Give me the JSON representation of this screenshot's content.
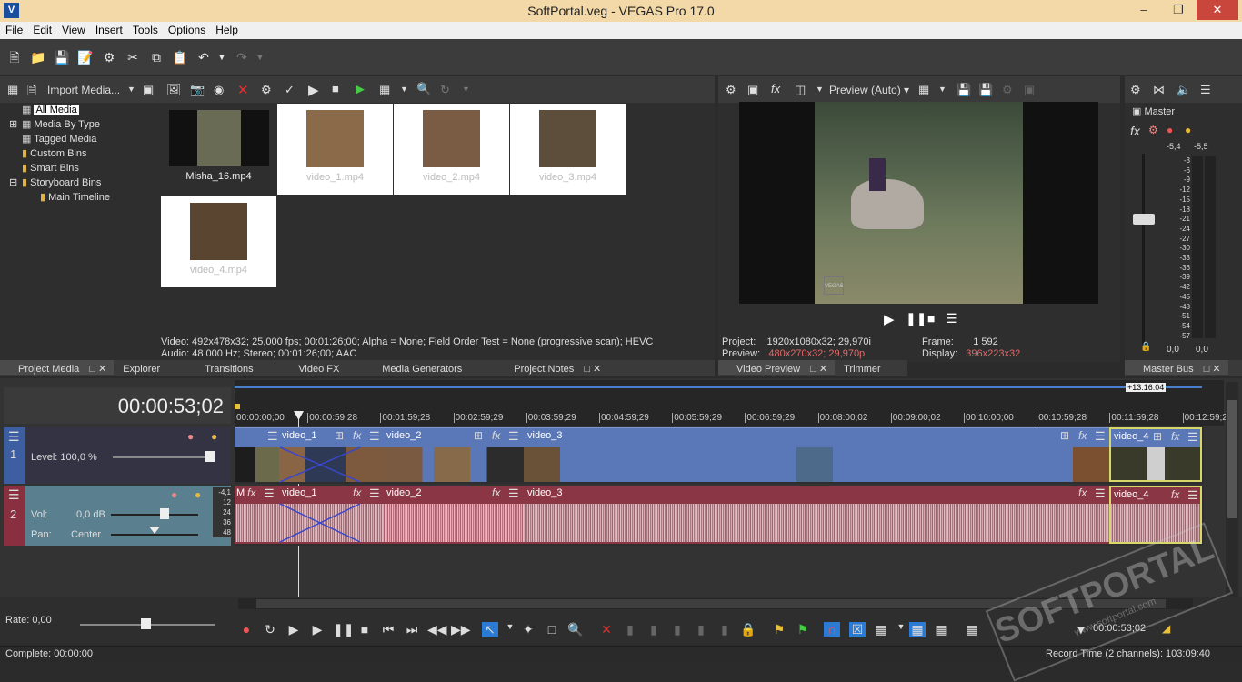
{
  "window": {
    "title": "SoftPortal.veg - VEGAS Pro 17.0",
    "app_icon": "V"
  },
  "menu": [
    "File",
    "Edit",
    "View",
    "Insert",
    "Tools",
    "Options",
    "Help"
  ],
  "media_toolbar": {
    "import_label": "Import Media..."
  },
  "media_tree": [
    "All Media",
    "Media By Type",
    "Tagged Media",
    "Custom Bins",
    "Smart Bins",
    "Storyboard Bins",
    "Main Timeline"
  ],
  "media_files": [
    "Misha_16.mp4",
    "video_1.mp4",
    "video_2.mp4",
    "video_3.mp4",
    "video_4.mp4"
  ],
  "media_info": {
    "video": "Video: 492x478x32; 25,000 fps; 00:01:26;00; Alpha = None; Field Order Test = None (progressive scan); HEVC",
    "audio": "Audio: 48 000 Hz; Stereo; 00:01:26;00; AAC"
  },
  "left_tabs": [
    "Project Media",
    "Explorer",
    "Transitions",
    "Video FX",
    "Media Generators",
    "Project Notes"
  ],
  "preview": {
    "mode": "Preview (Auto)",
    "project_label": "Project:",
    "project_value": "1920x1080x32; 29,970i",
    "preview_label": "Preview:",
    "preview_value": "480x270x32; 29,970p",
    "frame_label": "Frame:",
    "frame_value": "1 592",
    "display_label": "Display:",
    "display_value": "396x223x32",
    "watermark": "VEGAS"
  },
  "preview_tabs": [
    "Video Preview",
    "Trimmer"
  ],
  "master": {
    "label": "Master",
    "left_peak": "-5,4",
    "right_peak": "-5,5",
    "scale": [
      "3",
      "6",
      "9",
      "12",
      "15",
      "18",
      "21",
      "24",
      "27",
      "30",
      "33",
      "36",
      "39",
      "42",
      "45",
      "48",
      "51",
      "54",
      "57"
    ],
    "bottom_left": "0,0",
    "bottom_right": "0,0",
    "tab": "Master Bus"
  },
  "timeline": {
    "timecode": "00:00:53;02",
    "end_marker": "+13:16:04",
    "ruler": [
      "00:00:00;00",
      "00:00:59;28",
      "00:01:59;28",
      "00:02:59;29",
      "00:03:59;29",
      "00:04:59;29",
      "00:05:59;29",
      "00:06:59;29",
      "00:08:00;02",
      "00:09:00;02",
      "00:10:00;00",
      "00:10:59;28",
      "00:11:59;28",
      "00:12:59;2"
    ],
    "video_track": {
      "number": "1",
      "level": "Level: 100,0 %"
    },
    "audio_track": {
      "number": "2",
      "vol_label": "Vol:",
      "vol_value": "0,0 dB",
      "pan_label": "Pan:",
      "pan_value": "Center",
      "meter": [
        "-4,1",
        "12",
        "24",
        "36",
        "48"
      ]
    },
    "video_clips": [
      "video_1",
      "video_2",
      "video_3",
      "video_4"
    ],
    "audio_clips": [
      "M",
      "video_1",
      "video_2",
      "video_3",
      "video_4"
    ]
  },
  "transport": {
    "rate": "Rate: 0,00",
    "timecode": "00:00:53;02"
  },
  "status": {
    "complete": "Complete: 00:00:00",
    "record": "Record Time (2 channels): 103:09:40"
  },
  "watermark": {
    "brand": "SOFTPORTAL",
    "url": "www.softportal.com"
  }
}
